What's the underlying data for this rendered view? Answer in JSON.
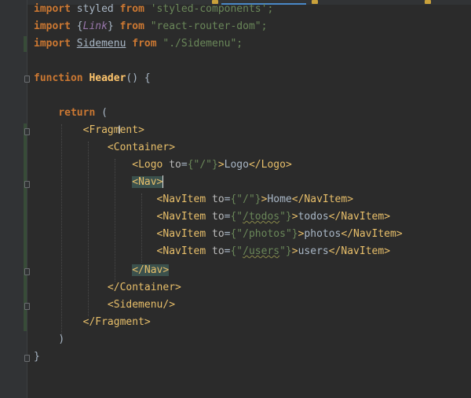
{
  "lines": [
    {
      "import": "import",
      "styled": "styled",
      "from": "from",
      "module": "'styled-components';"
    },
    {
      "import": "import",
      "brace_open": "{",
      "link": "Link",
      "brace_close": "}",
      "from": "from",
      "module": "\"react-router-dom\";"
    },
    {
      "import": "import",
      "sidemenu": "Sidemenu",
      "from": "from",
      "module": "\"./Sidemenu\";"
    },
    {
      "keyword": "function",
      "name": "Header",
      "rest": "() {"
    },
    {
      "keyword": "return",
      "rest": "("
    },
    {
      "open": "<",
      "name": "Fragment",
      "close": ">"
    },
    {
      "open": "<",
      "name": "Container",
      "close": ">"
    },
    {
      "open": "<",
      "name": "Logo",
      "attr": "to",
      "eq": "=",
      "value": "{\"/\"}",
      "gt": ">",
      "text": "Logo",
      "end_open": "</",
      "end_name": "Logo",
      "end_close": ">"
    },
    {
      "open": "<",
      "name": "Nav",
      "close": ">"
    },
    {
      "open": "<",
      "name": "NavItem",
      "attr": "to",
      "eq": "=",
      "value_pre": "{\"",
      "value_path": "/",
      "value_post": "\"}",
      "gt": ">",
      "text": "Home",
      "end_open": "</",
      "end_name": "NavItem",
      "end_close": ">"
    },
    {
      "open": "<",
      "name": "NavItem",
      "attr": "to",
      "eq": "=",
      "value_pre": "{\"",
      "value_path": "/todos",
      "value_post": "\"}",
      "gt": ">",
      "text": "todos",
      "end_open": "</",
      "end_name": "NavItem",
      "end_close": ">"
    },
    {
      "open": "<",
      "name": "NavItem",
      "attr": "to",
      "eq": "=",
      "value_pre": "{\"",
      "value_path": "/photos",
      "value_post": "\"}",
      "gt": ">",
      "text": "photos",
      "end_open": "</",
      "end_name": "NavItem",
      "end_close": ">"
    },
    {
      "open": "<",
      "name": "NavItem",
      "attr": "to",
      "eq": "=",
      "value_pre": "{\"",
      "value_path": "/users",
      "value_post": "\"}",
      "gt": ">",
      "text": "users",
      "end_open": "</",
      "end_name": "NavItem",
      "end_close": ">"
    },
    {
      "open": "</",
      "name": "Nav",
      "close": ">"
    },
    {
      "open": "</",
      "name": "Container",
      "close": ">"
    },
    {
      "open": "<",
      "name": "Sidemenu",
      "close": "/>"
    },
    {
      "open": "</",
      "name": "Fragment",
      "close": ">"
    },
    {
      "text": ")"
    },
    {
      "text": "}"
    }
  ],
  "colors": {
    "background": "#2b2b2b",
    "keyword": "#cc7832",
    "string": "#6a8759",
    "function": "#ffc66d",
    "tag": "#e8bf6a",
    "match_highlight": "#3b514d"
  }
}
